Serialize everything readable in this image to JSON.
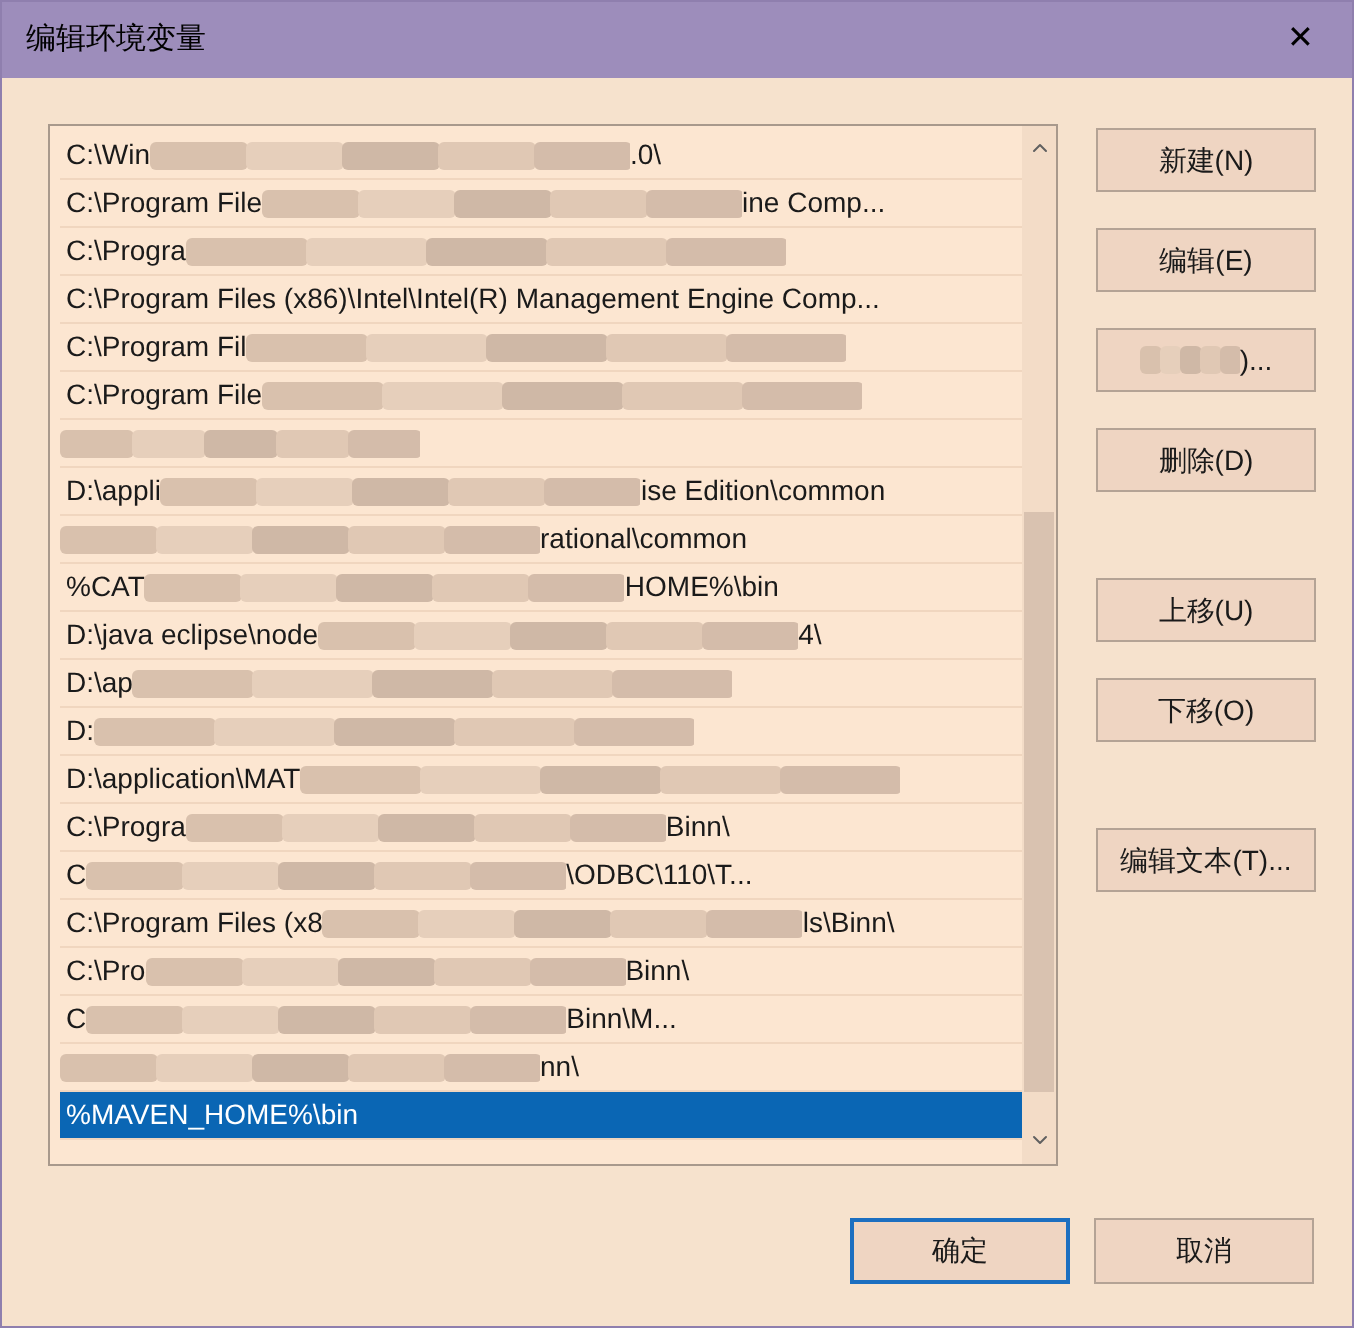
{
  "window": {
    "title": "编辑环境变量",
    "close": "✕"
  },
  "list": {
    "rows": [
      {
        "text": "C:\\Win",
        "tail": ".0\\",
        "selected": false
      },
      {
        "text": "C:\\Program File",
        "tail": "ine Comp...",
        "selected": false
      },
      {
        "text": "C:\\Progra",
        "selected": false
      },
      {
        "text": "C:\\Program Files (x86)\\Intel\\Intel(R) Management Engine Comp...",
        "selected": false
      },
      {
        "text": "C:\\Program Fil",
        "selected": false
      },
      {
        "text": "C:\\Program File",
        "selected": false
      },
      {
        "selected": false
      },
      {
        "text": "D:\\appli",
        "tail": "ise Edition\\common",
        "selected": false
      },
      {
        "tail": "rational\\common",
        "selected": false
      },
      {
        "text": "%CAT",
        "tail": "HOME%\\bin",
        "selected": false
      },
      {
        "text": "D:\\java eclipse\\node",
        "tail": "4\\",
        "selected": false
      },
      {
        "text": "D:\\ap",
        "selected": false
      },
      {
        "text": "D:",
        "selected": false
      },
      {
        "text": "D:\\application\\MAT",
        "selected": false
      },
      {
        "text": "C:\\Progra",
        "tail": "Binn\\",
        "selected": false
      },
      {
        "text": "C",
        "tail": "\\ODBC\\110\\T...",
        "selected": false
      },
      {
        "text": "C:\\Program Files (x8",
        "tail": "ls\\Binn\\",
        "selected": false
      },
      {
        "text": "C:\\Pro",
        "tail": "Binn\\",
        "selected": false
      },
      {
        "text": "C",
        "tail": "Binn\\M...",
        "selected": false
      },
      {
        "tail": "nn\\",
        "selected": false
      },
      {
        "text": "%MAVEN_HOME%\\bin",
        "selected": true
      }
    ]
  },
  "side_button_groups": [
    [
      {
        "label": "新建(N)"
      },
      {
        "label": "编辑(E)"
      },
      {
        "tail": ")..."
      },
      {
        "label": "删除(D)"
      }
    ],
    [
      {
        "label": "上移(U)"
      },
      {
        "label": "下移(O)"
      }
    ],
    [
      {
        "label": "编辑文本(T)..."
      }
    ]
  ],
  "footer": [
    {
      "label": "确定",
      "default": true
    },
    {
      "label": "取消",
      "default": false
    }
  ]
}
